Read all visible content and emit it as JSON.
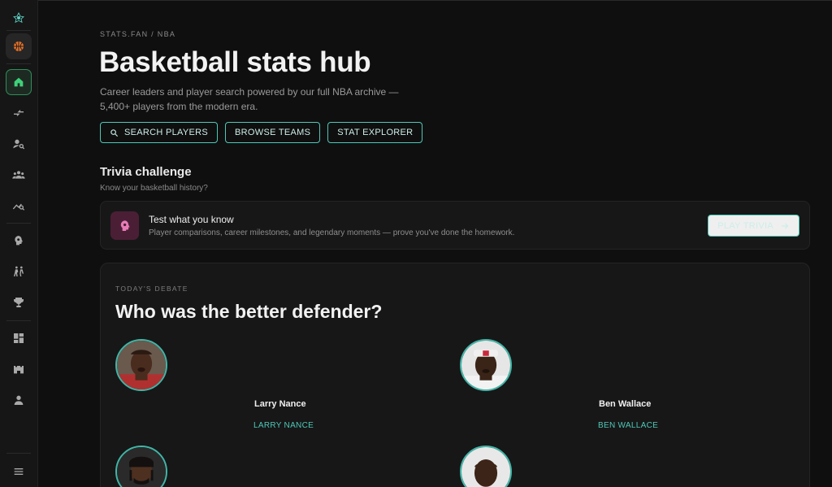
{
  "breadcrumb": "STATS.FAN / NBA",
  "page_title": "Basketball stats hub",
  "subtitle": "Career leaders and player search powered by our full NBA archive — 5,400+ players from the modern era.",
  "cta": {
    "search_players": "SEARCH PLAYERS",
    "browse_teams": "BROWSE TEAMS",
    "stat_explorer": "STAT EXPLORER"
  },
  "trivia": {
    "section_title": "Trivia challenge",
    "section_sub": "Know your basketball history?",
    "card_title": "Test what you know",
    "card_desc": "Player comparisons, career milestones, and legendary moments — prove you've done the homework.",
    "button": "PLAY TRIVIA"
  },
  "debate": {
    "tag": "TODAY'S DEBATE",
    "question": "Who was the better defender?",
    "players": [
      {
        "name": "Larry Nance",
        "link": "LARRY NANCE"
      },
      {
        "name": "Ben Wallace",
        "link": "BEN WALLACE"
      }
    ]
  },
  "sidebar": {
    "icons": [
      "logo-icon",
      "basketball-icon",
      "home-icon",
      "compare-icon",
      "player-search-icon",
      "teams-icon",
      "stats-trend-icon",
      "trivia-brain-icon",
      "matchup-icon",
      "trophy-icon",
      "dashboard-icon",
      "arena-icon",
      "profile-icon",
      "menu-icon"
    ]
  },
  "colors": {
    "accent": "#4fc8b8",
    "active_nav": "#2f8f5a",
    "background": "#0f0f0f",
    "card": "#171717"
  }
}
